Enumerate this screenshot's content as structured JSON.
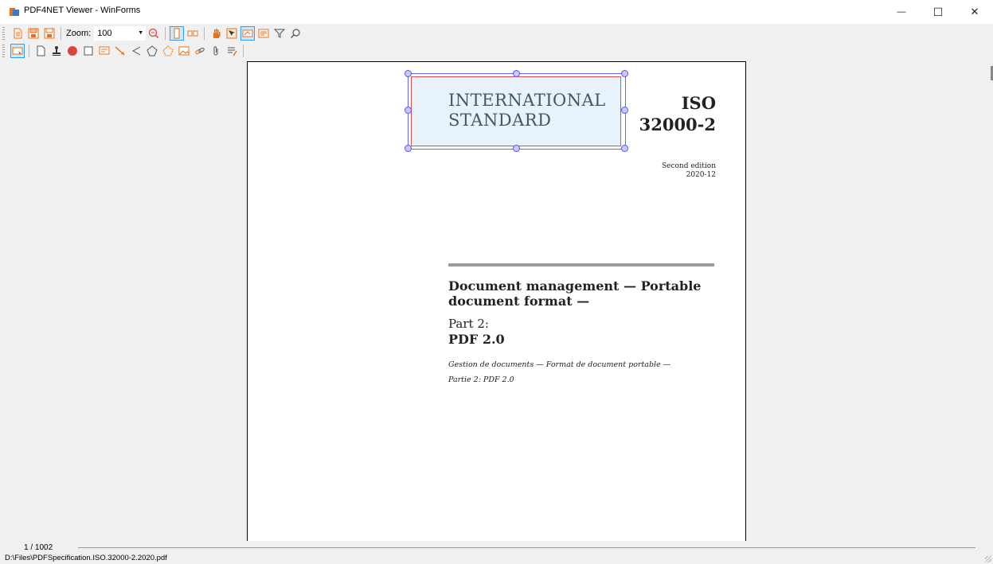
{
  "window": {
    "title": "PDF4NET Viewer - WinForms",
    "minimize_glyph": "—",
    "maximize_glyph": "☐",
    "close_glyph": "✕"
  },
  "toolbar": {
    "zoom_label": "Zoom:",
    "zoom_value": "100",
    "buttons_row1": [
      "open-icon",
      "save-icon",
      "save-as-icon",
      "zoom-icon",
      "single-page-icon",
      "two-page-icon",
      "hand-tool-icon",
      "select-text-icon",
      "select-annotation-icon",
      "form-icon",
      "filter-icon",
      "search-icon"
    ],
    "buttons_row2": [
      "select-rectangle-icon",
      "page-icon",
      "stamp-icon",
      "circle-icon",
      "square-icon",
      "text-box-icon",
      "line-icon",
      "polyline-icon",
      "polygon-icon",
      "cloud-icon",
      "image-icon",
      "link-icon",
      "attachment-icon",
      "ink-icon"
    ]
  },
  "page": {
    "banner_line1": "INTERNATIONAL",
    "banner_line2": "STANDARD",
    "iso_label": "ISO",
    "iso_number": "32000-2",
    "edition": "Second edition",
    "edition_date": "2020-12",
    "title_line1": "Document management — Portable",
    "title_line2": "document format —",
    "part_label": "Part 2:",
    "part_title": "PDF 2.0",
    "french_line1": "Gestion de documents — Format de document portable —",
    "french_line2": "Partie 2: PDF 2.0"
  },
  "footer": {
    "page_indicator": "1 / 1002"
  },
  "status": {
    "file_path": "D:\\Files\\PDFSpecification.ISO.32000-2.2020.pdf"
  },
  "colors": {
    "annotation_border": "#6666ff",
    "annotation_inner_border": "#e05050",
    "annotation_fill": "#e8f2fb",
    "accent_selected": "#3399ff",
    "icon_orange": "#e8701a",
    "icon_red": "#d9453b"
  }
}
